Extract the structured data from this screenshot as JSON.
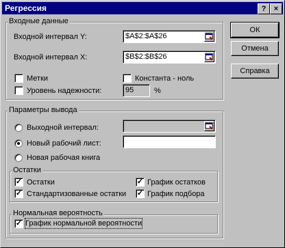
{
  "window": {
    "title": "Регрессия",
    "help_btn": "?",
    "close_btn": "×"
  },
  "input_group": {
    "title": "Входные данные",
    "y_label": "Входной интервал Y:",
    "y_value": "$A$2:$A$26",
    "x_label": "Входной интервал X:",
    "x_value": "$B$2:$B$26",
    "labels_cb": "Метки",
    "constant_cb": "Константа - ноль",
    "confidence_cb": "Уровень надежности:",
    "confidence_value": "95",
    "percent": "%"
  },
  "output_group": {
    "title": "Параметры вывода",
    "output_range": "Выходной интервал:",
    "new_sheet": "Новый рабочий лист:",
    "new_workbook": "Новая рабочая книга"
  },
  "residuals_group": {
    "title": "Остатки",
    "residuals": "Остатки",
    "standardized": "Стандартизованные остатки",
    "residual_plot": "График остатков",
    "fit_plot": "График подбора"
  },
  "normal_group": {
    "title": "Нормальная вероятность",
    "normal_plot": "График нормальной вероятности"
  },
  "buttons": {
    "ok": "ОК",
    "cancel": "Отмена",
    "help": "Справка"
  },
  "check_mark": "✓"
}
